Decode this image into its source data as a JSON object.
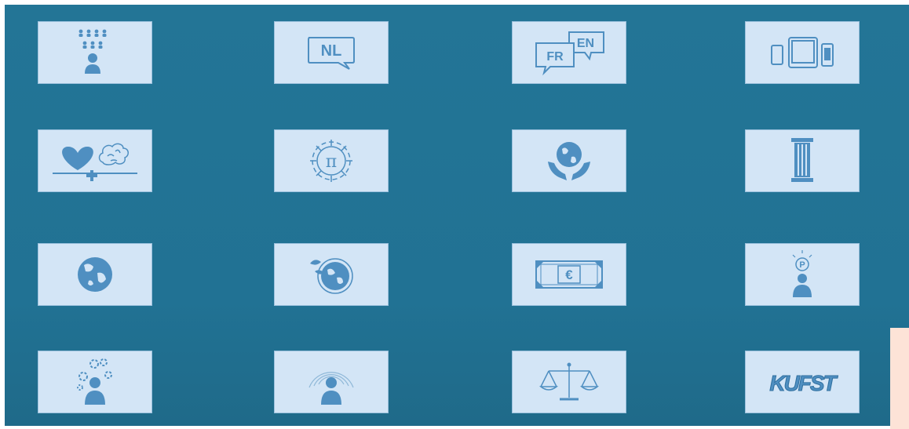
{
  "colors": {
    "background": "#237596",
    "tile": "#d3e5f6",
    "icon": "#4f8fc1",
    "accent_peach": "#fde3d7"
  },
  "tiles": [
    {
      "name": "group-hierarchy-icon"
    },
    {
      "name": "dutch-speech-bubble-icon",
      "label": "NL"
    },
    {
      "name": "french-english-bubbles-icon",
      "labels": [
        "FR",
        "EN"
      ]
    },
    {
      "name": "devices-icon"
    },
    {
      "name": "heart-plus-brain-icon"
    },
    {
      "name": "pi-gear-icon"
    },
    {
      "name": "globe-in-hands-icon"
    },
    {
      "name": "column-pillar-icon"
    },
    {
      "name": "globe-icon"
    },
    {
      "name": "globe-with-leaves-icon"
    },
    {
      "name": "euro-banknote-icon",
      "label": "€"
    },
    {
      "name": "person-with-p-bubble-icon",
      "label": "P"
    },
    {
      "name": "person-with-gears-icon"
    },
    {
      "name": "person-broadcast-icon"
    },
    {
      "name": "balance-scale-icon"
    },
    {
      "name": "graffiti-logo-icon",
      "label": "KUFST"
    }
  ]
}
